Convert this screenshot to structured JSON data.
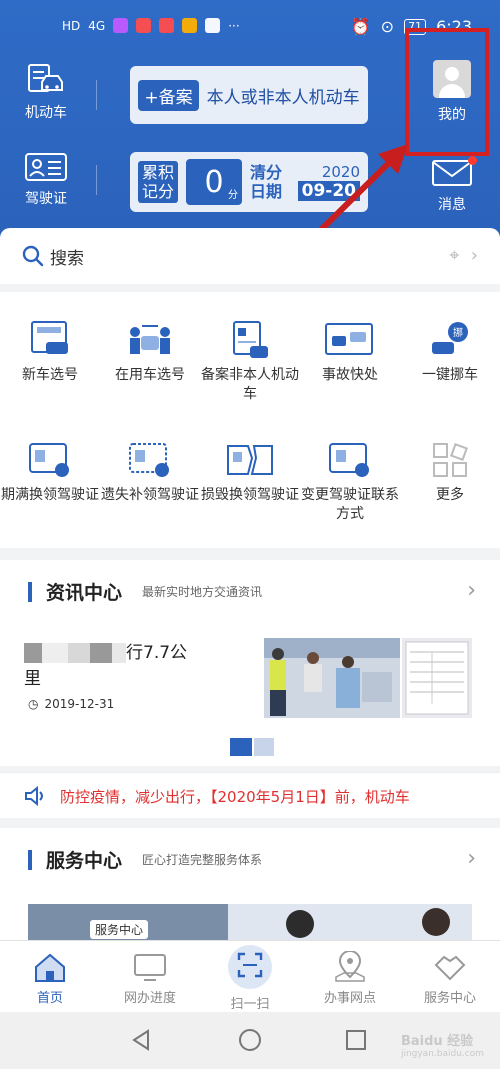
{
  "status_bar": {
    "network": "HD",
    "signal": "4G",
    "battery": "71",
    "time": "6:23"
  },
  "header": {
    "vehicle_label": "机动车",
    "license_label": "驾驶证",
    "register_badge": "+备案",
    "register_text": "本人或非本人机动车",
    "points_label_1": "累积",
    "points_label_2": "记分",
    "points_value": "0",
    "points_unit": "分",
    "clear_label_1": "清分",
    "clear_label_2": "日期",
    "clear_year": "2020",
    "clear_date": "09-20",
    "mine_label": "我的",
    "messages_label": "消息"
  },
  "search": {
    "label": "搜索"
  },
  "services": [
    {
      "label": "新车选号",
      "icon": "new-car-plate-icon"
    },
    {
      "label": "在用车选号",
      "icon": "used-car-plate-icon"
    },
    {
      "label": "备案非本人机动车",
      "icon": "register-vehicle-icon"
    },
    {
      "label": "事故快处",
      "icon": "accident-icon"
    },
    {
      "label": "一键挪车",
      "icon": "move-car-icon"
    },
    {
      "label": "期满换领驾驶证",
      "icon": "renew-license-icon"
    },
    {
      "label": "遗失补领驾驶证",
      "icon": "lost-license-icon"
    },
    {
      "label": "损毁换领驾驶证",
      "icon": "damaged-license-icon"
    },
    {
      "label": "变更驾驶证联系方式",
      "icon": "change-contact-icon"
    },
    {
      "label": "更多",
      "icon": "more-icon"
    }
  ],
  "news": {
    "title": "资讯中心",
    "subtitle": "最新实时地方交通资讯",
    "article_title_visible": "行7.7公",
    "article_title_line2": "里",
    "article_date": "2019-12-31"
  },
  "ticker": {
    "text": "防控疫情，减少出行，【2020年5月1日】前，机动车"
  },
  "service_center": {
    "title": "服务中心",
    "subtitle": "匠心打造完整服务体系",
    "banner_tag": "服务中心"
  },
  "bottom_nav": {
    "home": "首页",
    "progress": "网办进度",
    "scan": "扫一扫",
    "outlets": "办事网点",
    "center": "服务中心"
  },
  "watermark": {
    "brand": "Baidu 经验",
    "url": "jingyan.baidu.com"
  },
  "colors": {
    "primary": "#2b62bb",
    "alert": "#d42020",
    "ticker": "#e03030"
  }
}
